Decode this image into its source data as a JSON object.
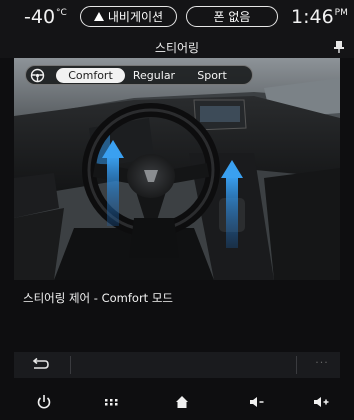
{
  "status_bar": {
    "temperature": "-40",
    "temperature_unit": "°C",
    "navigation_label": "내비게이션",
    "phone_label": "폰 없음",
    "time": "1:46",
    "time_suffix": "PM"
  },
  "header": {
    "title": "스티어링",
    "pin_icon": "pin-icon"
  },
  "mode_selector": {
    "icon": "steering-wheel-icon",
    "options": [
      "Comfort",
      "Regular",
      "Sport"
    ],
    "selected": "Comfort"
  },
  "caption": "스티어링 제어 - Comfort 모드",
  "action_bar": {
    "back_icon": "back-icon",
    "more_icon": "more-icon",
    "more_label": "···"
  },
  "bottom_nav": {
    "items": [
      "power-icon",
      "apps-grid-icon",
      "home-icon",
      "volume-down-icon",
      "volume-up-icon"
    ]
  },
  "colors": {
    "background": "#0e0e10",
    "bar": "#141416",
    "accent_blue": "#2e8fe0",
    "selected_pill": "#f2f2f2"
  }
}
